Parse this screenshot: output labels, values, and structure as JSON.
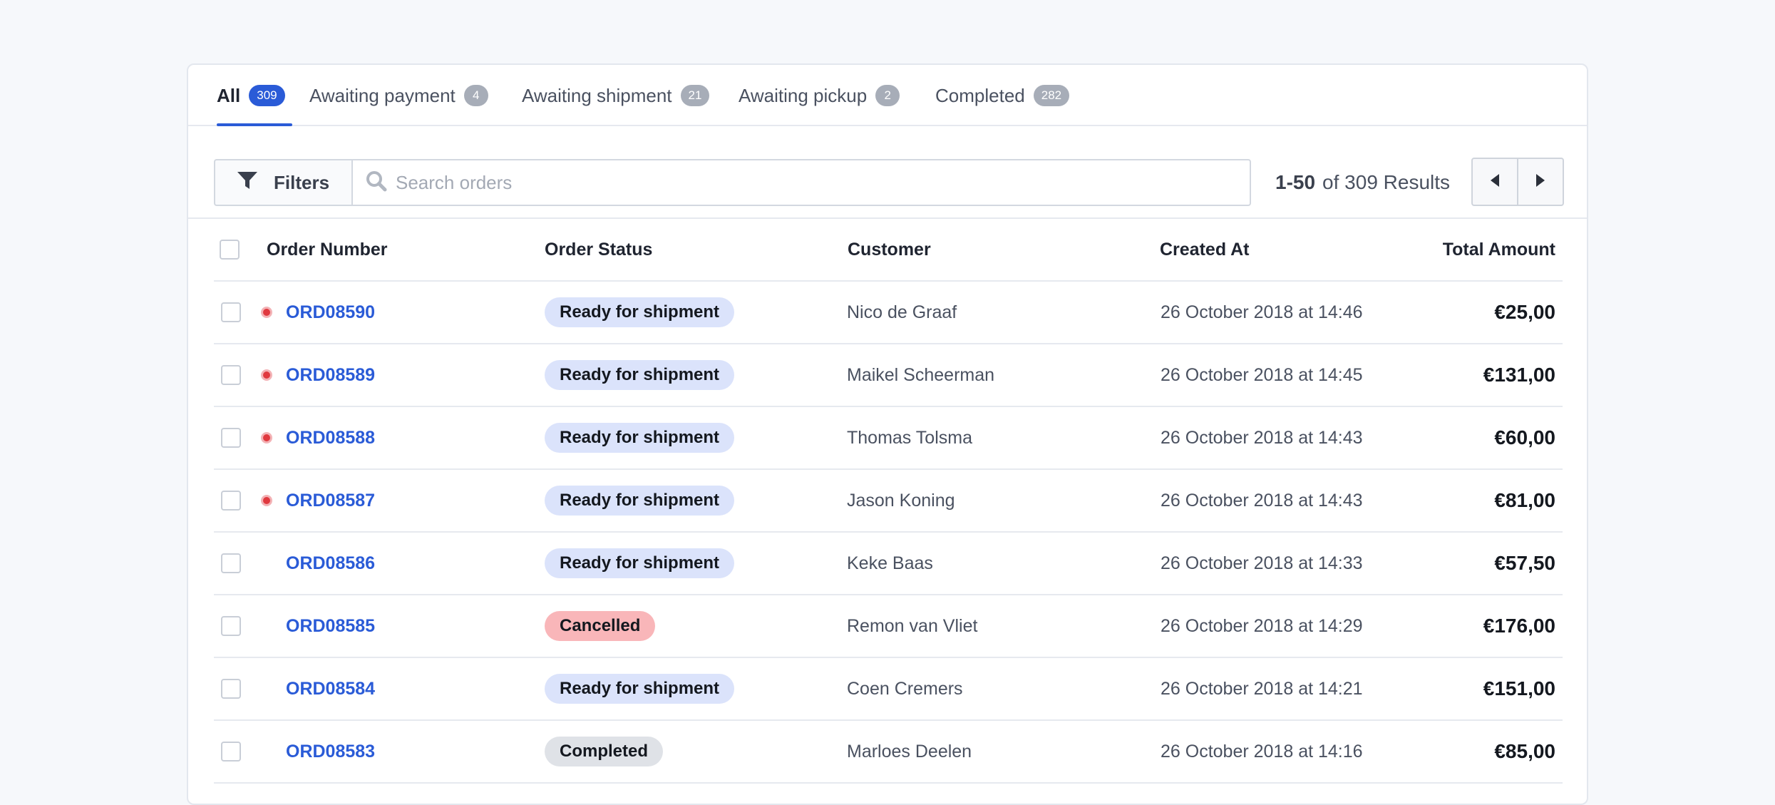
{
  "tabs": [
    {
      "label": "All",
      "count": "309",
      "active": true
    },
    {
      "label": "Awaiting payment",
      "count": "4"
    },
    {
      "label": "Awaiting shipment",
      "count": "21"
    },
    {
      "label": "Awaiting pickup",
      "count": "2"
    },
    {
      "label": "Completed",
      "count": "282"
    }
  ],
  "toolbar": {
    "filters_label": "Filters",
    "search_placeholder": "Search orders",
    "results_range": "1-50",
    "results_total": "of 309 Results"
  },
  "table": {
    "headers": {
      "order_number": "Order Number",
      "order_status": "Order Status",
      "customer": "Customer",
      "created_at": "Created At",
      "total_amount": "Total Amount"
    },
    "rows": [
      {
        "order": "ORD08590",
        "flag": true,
        "status": "Ready for shipment",
        "status_kind": "ready",
        "customer": "Nico de Graaf",
        "created": "26 October 2018 at 14:46",
        "amount": "€25,00"
      },
      {
        "order": "ORD08589",
        "flag": true,
        "status": "Ready for shipment",
        "status_kind": "ready",
        "customer": "Maikel Scheerman",
        "created": "26 October 2018 at 14:45",
        "amount": "€131,00"
      },
      {
        "order": "ORD08588",
        "flag": true,
        "status": "Ready for shipment",
        "status_kind": "ready",
        "customer": "Thomas Tolsma",
        "created": "26 October 2018 at 14:43",
        "amount": "€60,00"
      },
      {
        "order": "ORD08587",
        "flag": true,
        "status": "Ready for shipment",
        "status_kind": "ready",
        "customer": "Jason Koning",
        "created": "26 October 2018 at 14:43",
        "amount": "€81,00"
      },
      {
        "order": "ORD08586",
        "flag": false,
        "status": "Ready for shipment",
        "status_kind": "ready",
        "customer": "Keke Baas",
        "created": "26 October 2018 at 14:33",
        "amount": "€57,50"
      },
      {
        "order": "ORD08585",
        "flag": false,
        "status": "Cancelled",
        "status_kind": "cancelled",
        "customer": "Remon van Vliet",
        "created": "26 October 2018 at 14:29",
        "amount": "€176,00"
      },
      {
        "order": "ORD08584",
        "flag": false,
        "status": "Ready for shipment",
        "status_kind": "ready",
        "customer": "Coen Cremers",
        "created": "26 October 2018 at 14:21",
        "amount": "€151,00"
      },
      {
        "order": "ORD08583",
        "flag": false,
        "status": "Completed",
        "status_kind": "completed",
        "customer": "Marloes Deelen",
        "created": "26 October 2018 at 14:16",
        "amount": "€85,00"
      }
    ]
  },
  "colors": {
    "accent": "#2a5bd7",
    "badge_ready": "#dbe3fb",
    "badge_cancelled": "#f9b6b9",
    "badge_completed": "#dfe2e7",
    "flag_dot": "#e0393f"
  },
  "icons": {
    "filter": "funnel-icon",
    "search": "search-icon",
    "prev": "triangle-left-icon",
    "next": "triangle-right-icon",
    "flag": "red-dot-icon"
  }
}
